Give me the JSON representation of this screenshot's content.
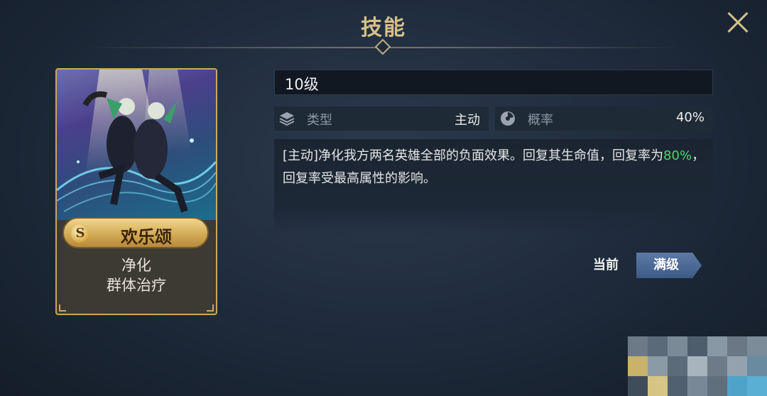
{
  "header": {
    "title": "技能"
  },
  "card": {
    "rarity": "S",
    "name": "欢乐颂",
    "tags": [
      "净化",
      "群体治疗"
    ]
  },
  "skill": {
    "level": "10级",
    "type_label": "类型",
    "type_value": "主动",
    "rate_label": "概率",
    "rate_value": "40%",
    "desc_part1": "[主动]净化我方两名英雄全部的负面效果。回复其生命值，回复率为",
    "desc_highlight": "80%",
    "desc_part2": "，回复率受最高属性的影响。"
  },
  "tabs": {
    "current": "当前",
    "max": "满级"
  },
  "colors": {
    "title_gold": "#d6c08a",
    "highlight_green": "#3fdc6a",
    "tab_active": "#4a6794"
  },
  "icons": [
    "close-icon",
    "layers-icon",
    "dial-icon"
  ]
}
